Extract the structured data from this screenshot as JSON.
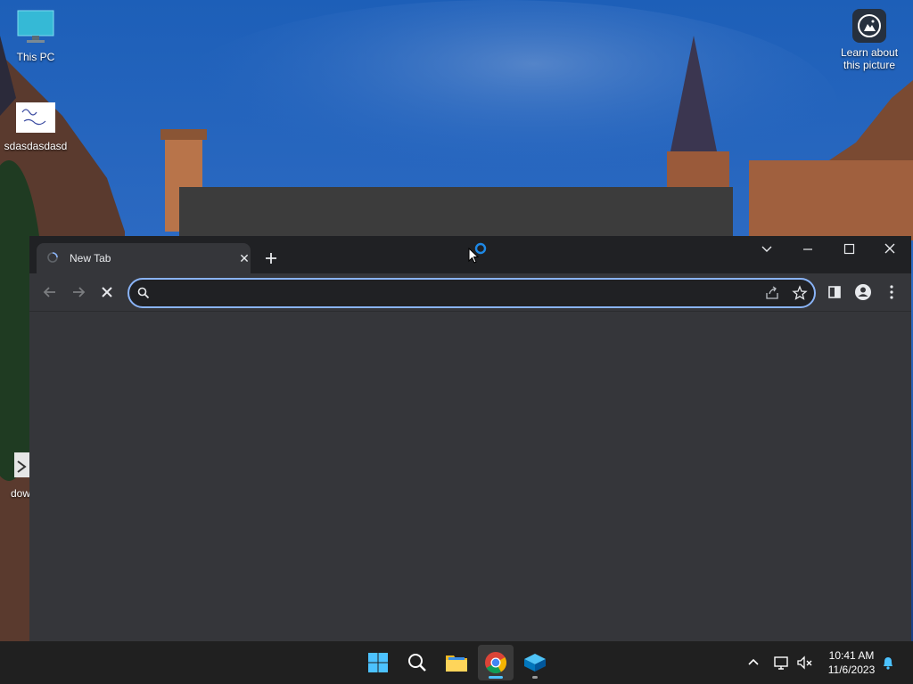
{
  "desktop": {
    "icons": [
      {
        "label": "This PC"
      },
      {
        "label": "sdasdasdasd"
      },
      {
        "label": "dow"
      }
    ],
    "spotlight": {
      "label_line1": "Learn about",
      "label_line2": "this picture"
    }
  },
  "browser": {
    "tab": {
      "title": "New Tab",
      "close_glyph": "✕"
    },
    "omnibox": {
      "value": "",
      "placeholder": ""
    },
    "colors": {
      "frame": "#202124",
      "toolbar": "#35363a",
      "accent": "#8ab4f8"
    }
  },
  "taskbar": {
    "apps": [
      "start-icon",
      "search-icon",
      "file-explorer-icon",
      "chrome-icon",
      "app-icon"
    ],
    "clock": {
      "time": "10:41 AM",
      "date": "11/6/2023"
    }
  }
}
